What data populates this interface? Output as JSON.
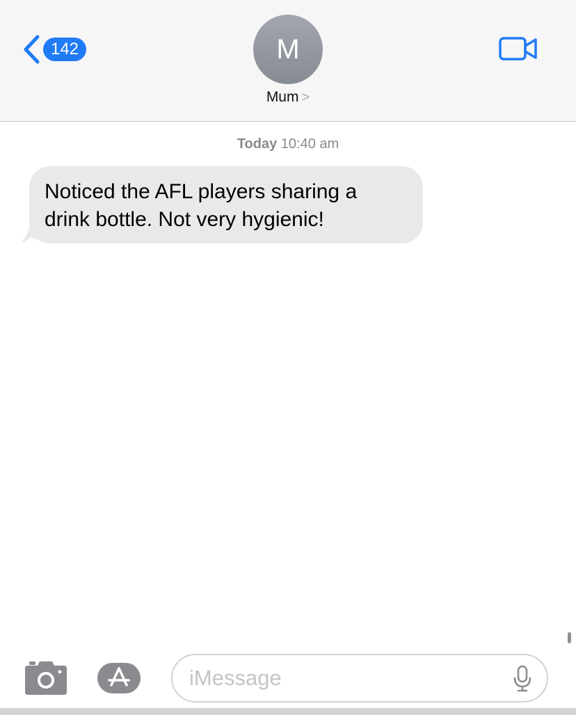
{
  "header": {
    "unread_count": "142",
    "avatar_initial": "M",
    "contact_name": "Mum",
    "contact_chevron": ">"
  },
  "conversation": {
    "timestamp_day": "Today",
    "timestamp_time": "10:40 am",
    "messages": [
      {
        "direction": "received",
        "text": "Noticed the AFL players sharing a drink bottle. Not very hygienic!"
      }
    ]
  },
  "composer": {
    "placeholder": "iMessage"
  },
  "icons": {
    "back": "chevron-left-icon",
    "video": "video-camera-icon",
    "camera": "camera-icon",
    "apps": "app-store-icon",
    "mic": "microphone-icon"
  },
  "colors": {
    "accent": "#1f7bf6",
    "received_bubble": "#e9e9eb",
    "avatar": "#8e939a",
    "header_bg": "#f6f6f6"
  }
}
